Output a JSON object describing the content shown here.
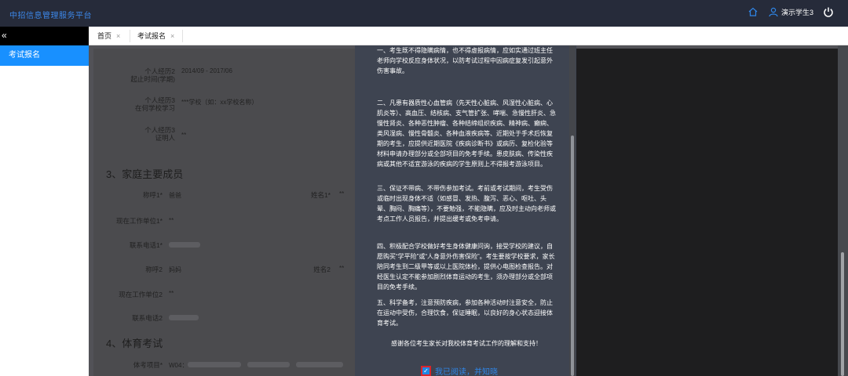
{
  "app": {
    "title": "中招信息管理服务平台"
  },
  "header": {
    "user_name": "演示学生3",
    "icons": [
      "home-icon",
      "user-icon",
      "power-icon"
    ]
  },
  "sidebar": {
    "collapse_icon": "«",
    "items": [
      {
        "label": "考试报名",
        "active": true
      }
    ]
  },
  "tabs": [
    {
      "label": "首页",
      "close": "×"
    },
    {
      "label": "考试报名",
      "close": "×"
    }
  ],
  "form": {
    "resume2": {
      "label1": "个人经历2",
      "label2": "起止时间(学期)",
      "value": "2014/09 - 2017/06"
    },
    "resume3": {
      "label1": "个人经历3",
      "label2": "在何学校学习",
      "value": "***学校（如：xx学校名称）"
    },
    "resume_witness": {
      "label1": "个人经历3",
      "label2": "证明人",
      "value": "**"
    },
    "family_section": "3、家庭主要成员",
    "member1": {
      "label": "称呼1*",
      "value": "爸爸",
      "name_label": "姓名1*",
      "name_value": "**"
    },
    "work_unit1": {
      "label": "现在工作单位1*",
      "value": "**"
    },
    "phone1": {
      "label": "联系电话1*"
    },
    "member2": {
      "label": "称呼2",
      "value": "妈妈",
      "name_label": "姓名2",
      "name_value": "**"
    },
    "work_unit2": {
      "label": "现在工作单位2",
      "value": "**"
    },
    "phone2": {
      "label": "联系电话2"
    },
    "pe_section": "4、体育考试",
    "pe_item": {
      "label": "体考项目*",
      "value": "W04："
    }
  },
  "modal": {
    "paragraphs": [
      "一、考生既不得隐瞒病情，也不得虚报病情，应如实通过班主任老师向学校反应身体状况，以防考试过程中因病症复发引起意外伤害事故。",
      "二、凡患有器质性心血管病（先天性心脏病、风湿性心脏病、心肌炎等）、高血压、结核病、支气管扩张、哮喘、急慢性肝炎、急慢性肾炎、各种恶性肿瘤、各种结缔组织疾病、精神病、癫痫、类风湿病、慢性骨髓炎、各种血液疾病等、近期处于手术后恢复期的考生，应提供近期医院《疾病诊断书》或病历、复检化验等材料申请办理部分或全部项目的免考手续。患皮肤病、传染性疾病或其他不适宜游泳的疾病的学生原则上不得报考游泳项目。",
      "三、保证不带病、不带伤参加考试。考前或考试期间，考生受伤或临时出现身体不适（如感冒、发热、腹泻、恶心、呕吐、头晕、胸闷、胸痛等），不要勉强，不能隐瞒，应及时主动向老师或考点工作人员报告，并提出缓考或免考申请。",
      "四、积极配合学校做好考生身体健康问询，接受学校的建议，自愿购买“学平险”或“人身意外伤害保险”。考生要按学校要求，家长陪同考生到二级甲等或以上医院体检，提供心电图检查报告。对经医生认定不能参加剧烈体育运动的考生，须办理部分或全部项目的免考手续。",
      "五、科学备考，注意预防疾病，参加各种活动时注意安全，防止在运动中受伤，合理饮食，保证睡眠，以良好的身心状态迎接体育考试。"
    ],
    "thanks": "感谢各位考生家长对我校体育考试工作的理解和支持！",
    "agree_text": "我已阅读，并知晓",
    "agree_checked": true,
    "checkbox_mark": "✓"
  }
}
